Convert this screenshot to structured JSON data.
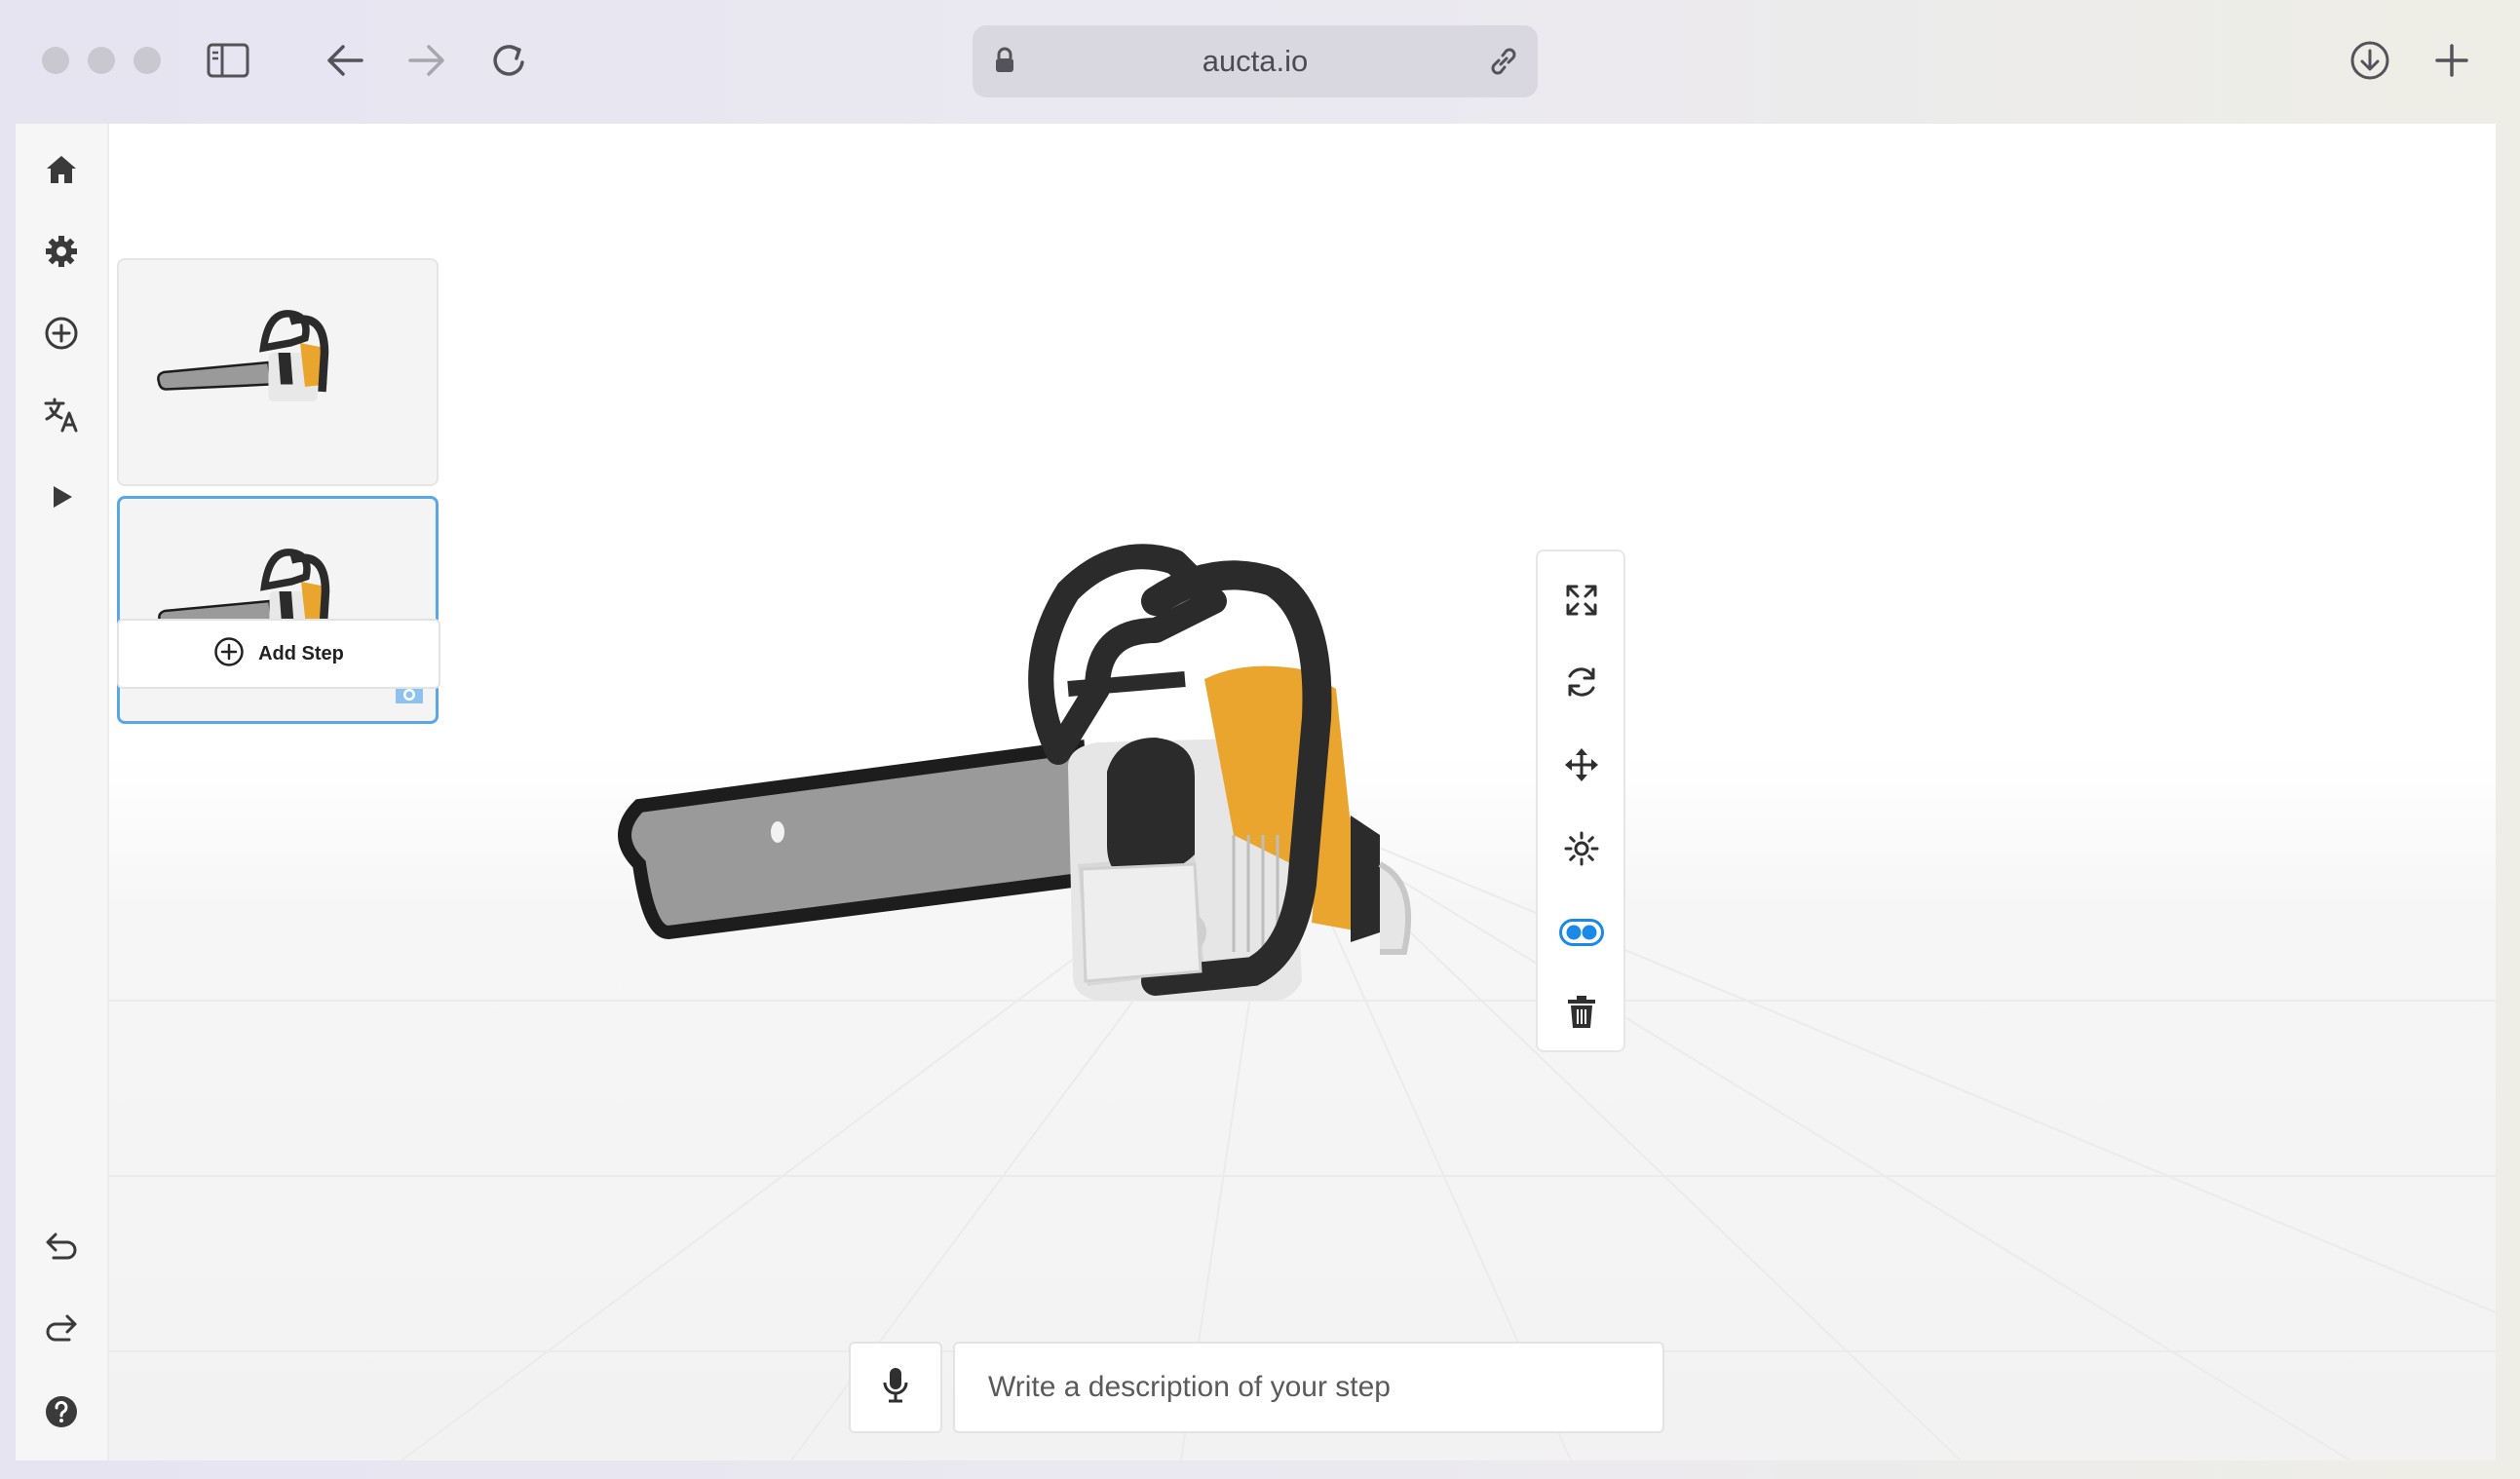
{
  "browser": {
    "url": "aucta.io"
  },
  "sidebar": {
    "items": [
      {
        "name": "home-icon"
      },
      {
        "name": "gear-icon"
      },
      {
        "name": "add-circle-icon"
      },
      {
        "name": "translate-icon"
      },
      {
        "name": "play-icon"
      },
      {
        "name": "undo-icon"
      },
      {
        "name": "redo-icon"
      },
      {
        "name": "help-icon"
      }
    ]
  },
  "steps": {
    "add_step_label": "Add Step",
    "count": "2"
  },
  "toolbar": {
    "tools": [
      "fullscreen-icon",
      "rotate-icon",
      "move-icon",
      "light-icon",
      "toggle-icon",
      "trash-icon"
    ],
    "accent": "#1a8ae6"
  },
  "composer": {
    "placeholder": "Write a description of your step"
  },
  "colors": {
    "selected_border": "#5aa7e6",
    "chainsaw_body": "#e9a52d",
    "chainsaw_handle": "#2b2b2b",
    "chainsaw_bar": "#9a9a9a"
  }
}
